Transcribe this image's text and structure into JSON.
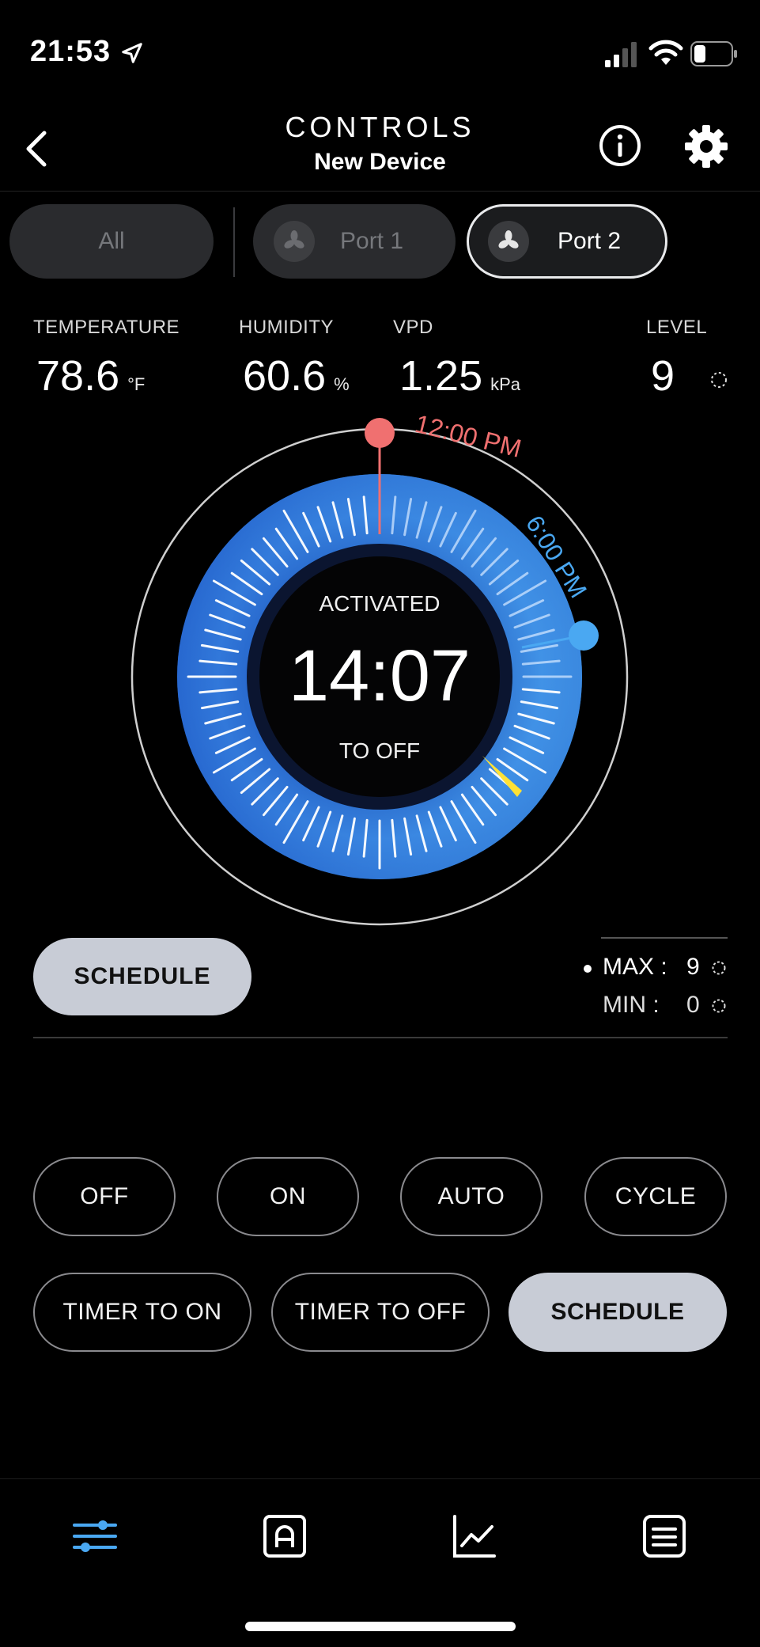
{
  "status_bar": {
    "time": "21:53"
  },
  "header": {
    "title": "CONTROLS",
    "subtitle": "New Device"
  },
  "tabs": [
    {
      "label": "All"
    },
    {
      "label": "Port 1"
    },
    {
      "label": "Port 2"
    }
  ],
  "readings": {
    "temperature": {
      "label": "TEMPERATURE",
      "value": "78.6",
      "unit": "°F"
    },
    "humidity": {
      "label": "HUMIDITY",
      "value": "60.6",
      "unit": "%"
    },
    "vpd": {
      "label": "VPD",
      "value": "1.25",
      "unit": "kPa"
    },
    "level": {
      "label": "LEVEL",
      "value": "9"
    }
  },
  "dial": {
    "start_label": "12:00 PM",
    "end_label": "6:00 PM",
    "status": "ACTIVATED",
    "countdown": "14:07",
    "action": "TO OFF",
    "colors": {
      "start": "#f07070",
      "end": "#4aa8f2",
      "ring": "#3d86e0",
      "now": "#ffe135"
    }
  },
  "schedule_pill": {
    "label": "SCHEDULE"
  },
  "maxmin": {
    "max": {
      "label": "MAX :",
      "value": "9"
    },
    "min": {
      "label": "MIN :",
      "value": "0"
    }
  },
  "modes": [
    {
      "label": "OFF"
    },
    {
      "label": "ON"
    },
    {
      "label": "AUTO"
    },
    {
      "label": "CYCLE"
    },
    {
      "label": "TIMER TO ON"
    },
    {
      "label": "TIMER TO OFF"
    },
    {
      "label": "SCHEDULE"
    }
  ],
  "bottom_nav": {
    "items": [
      "sliders-icon",
      "auto-icon",
      "chart-icon",
      "list-icon"
    ],
    "active_color": "#4aa8f2"
  }
}
